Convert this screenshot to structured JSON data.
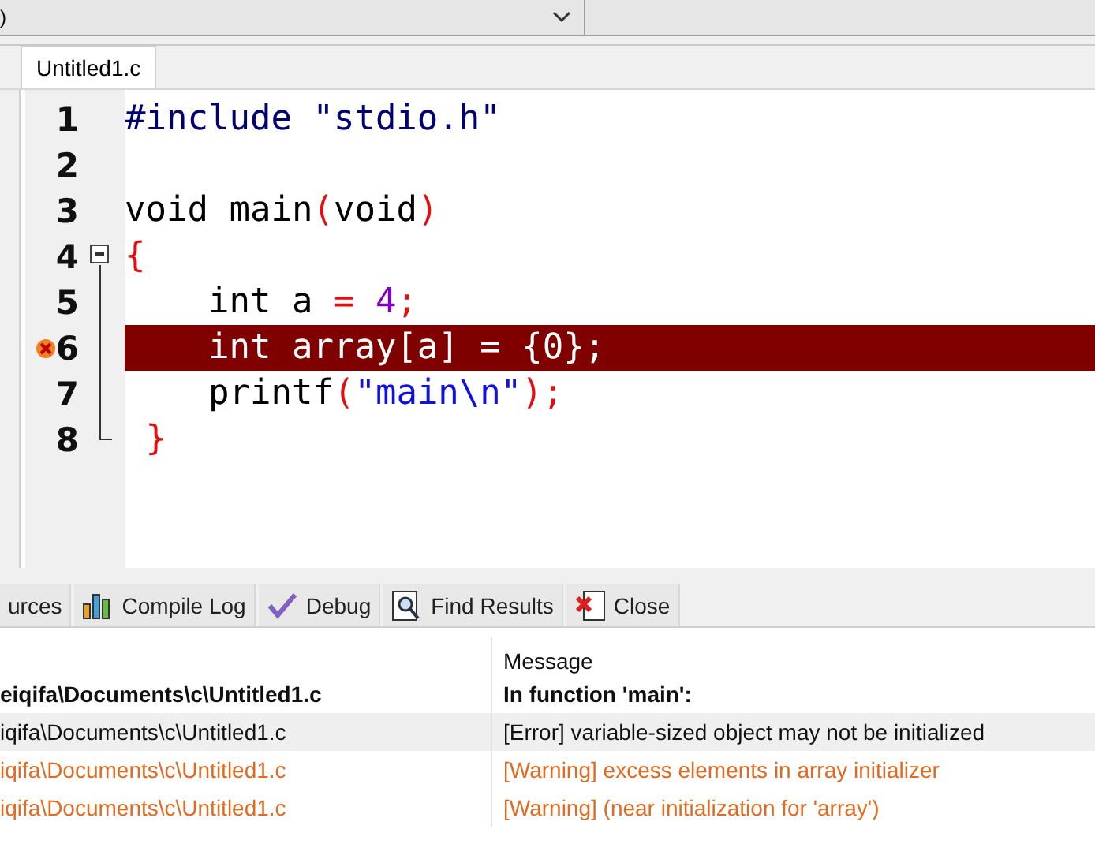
{
  "toolbar": {
    "combo_value": ")"
  },
  "editor_tabs": [
    {
      "label": "Untitled1.c",
      "selected": true
    }
  ],
  "code_lines": [
    {
      "number": "1",
      "tokens": [
        {
          "text": "#include \"stdio.h\"",
          "kind": "preproc"
        }
      ]
    },
    {
      "number": "2"
    },
    {
      "number": "3",
      "tokens": [
        {
          "text": "void main",
          "kind": "plain"
        },
        {
          "text": "(",
          "kind": "symbol"
        },
        {
          "text": "void",
          "kind": "plain"
        },
        {
          "text": ")",
          "kind": "symbol"
        }
      ]
    },
    {
      "number": "4",
      "expanded": true,
      "tokens": [
        {
          "text": "{",
          "kind": "symbol"
        }
      ]
    },
    {
      "number": "5",
      "tokens": [
        {
          "text": "    int a ",
          "kind": "plain"
        },
        {
          "text": "=",
          "kind": "symbol"
        },
        {
          "text": " 4",
          "kind": "number"
        },
        {
          "text": ";",
          "kind": "symbol"
        }
      ]
    },
    {
      "number": "6",
      "error": true,
      "tokens": [
        {
          "text": "    int array[a] = {0};",
          "kind": "plain"
        }
      ]
    },
    {
      "number": "7",
      "tokens": [
        {
          "text": "    printf",
          "kind": "plain"
        },
        {
          "text": "(",
          "kind": "symbol"
        },
        {
          "text": "\"main\\n\"",
          "kind": "string"
        },
        {
          "text": ");",
          "kind": "symbol"
        }
      ]
    },
    {
      "number": "8",
      "tokens": [
        {
          "text": " }",
          "kind": "symbol"
        }
      ]
    }
  ],
  "bottom_tabs": [
    {
      "label": "urces"
    },
    {
      "label": "Compile Log"
    },
    {
      "label": "Debug"
    },
    {
      "label": "Find Results"
    },
    {
      "label": "Close"
    }
  ],
  "messages_table": {
    "columns": [
      "Message"
    ],
    "rows": [
      {
        "kind": "header",
        "file": "eiqifa\\Documents\\c\\Untitled1.c",
        "message": "In function 'main':"
      },
      {
        "kind": "error",
        "file": "iqifa\\Documents\\c\\Untitled1.c",
        "message": "[Error] variable-sized object may not be initialized"
      },
      {
        "kind": "warning",
        "file": "iqifa\\Documents\\c\\Untitled1.c",
        "message": "[Warning] excess elements in array initializer"
      },
      {
        "kind": "warning",
        "file": "iqifa\\Documents\\c\\Untitled1.c",
        "message": "[Warning] (near initialization for 'array')"
      }
    ]
  }
}
